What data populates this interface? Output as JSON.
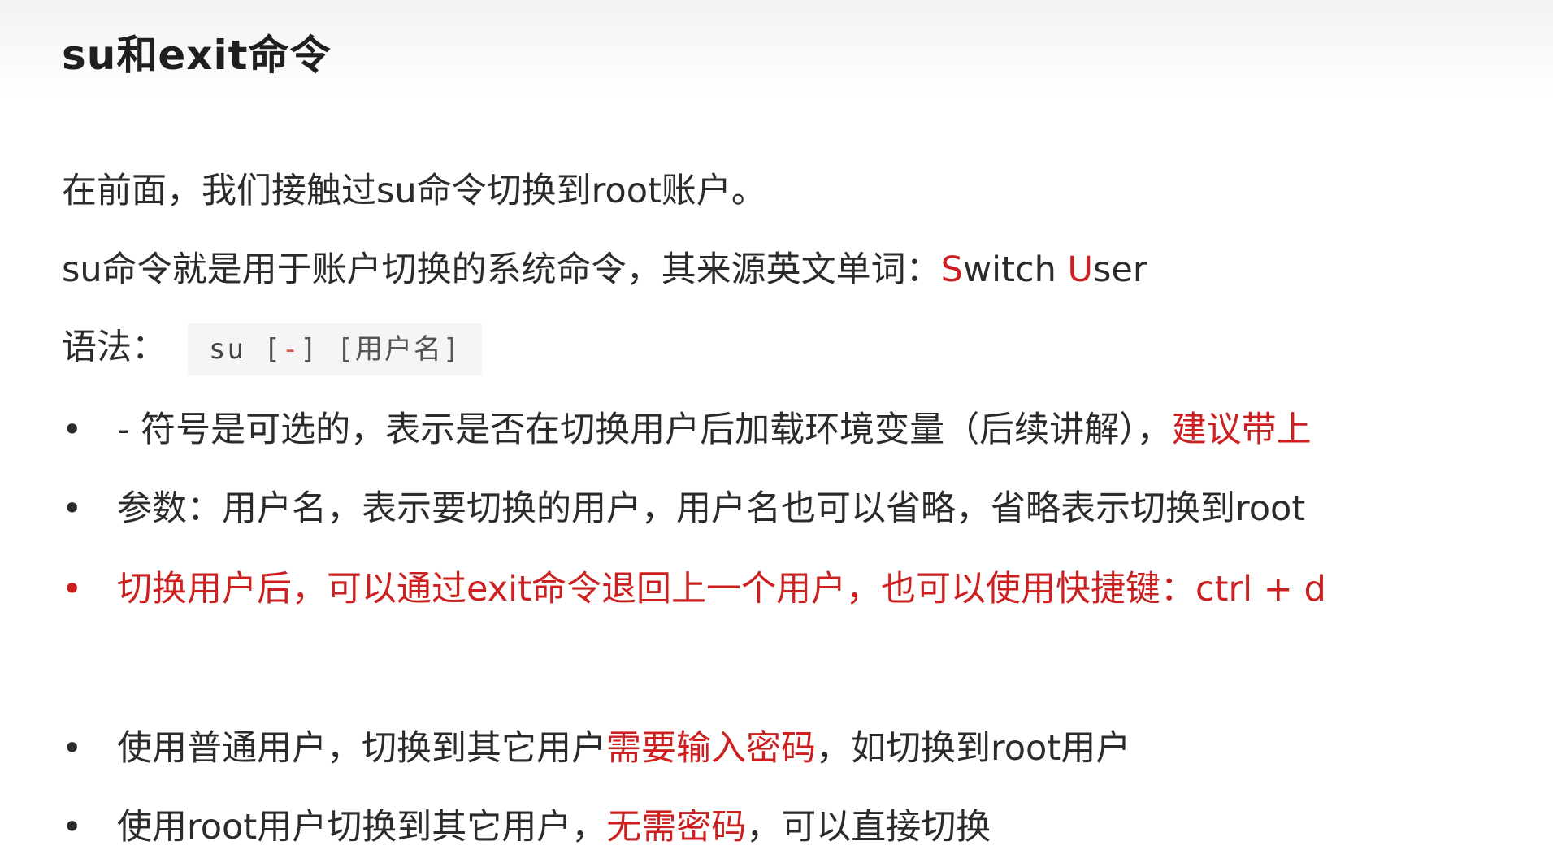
{
  "title": "su和exit命令",
  "intro": {
    "line1": "在前面，我们接触过su命令切换到root账户。",
    "line2_prefix": "su命令就是用于账户切换的系统命令，其来源英文单词：",
    "line2_s": "S",
    "line2_witch": "witch ",
    "line2_u": "U",
    "line2_ser": "ser"
  },
  "syntax": {
    "label": "语法：",
    "cmd": "su",
    "opt_open": "[",
    "opt_dash": "-",
    "opt_close": "]",
    "user_arg": "[用户名]"
  },
  "bullets": {
    "dot": "•",
    "b1_text": "- 符号是可选的，表示是否在切换用户后加载环境变量（后续讲解），",
    "b1_red": "建议带上",
    "b2_text": "参数：用户名，表示要切换的用户，用户名也可以省略，省略表示切换到root",
    "b3_text": "切换用户后，可以通过exit命令退回上一个用户，也可以使用快捷键：ctrl + d",
    "b4_text": "使用普通用户，切换到其它用户",
    "b4_red": "需要输入密码",
    "b4_tail": "，如切换到root用户",
    "b5_text": "使用root用户切换到其它用户，",
    "b5_red": "无需密码",
    "b5_tail": "，可以直接切换"
  },
  "colors": {
    "accent_red": "#cc1f1f",
    "text": "#2b2b2b"
  }
}
